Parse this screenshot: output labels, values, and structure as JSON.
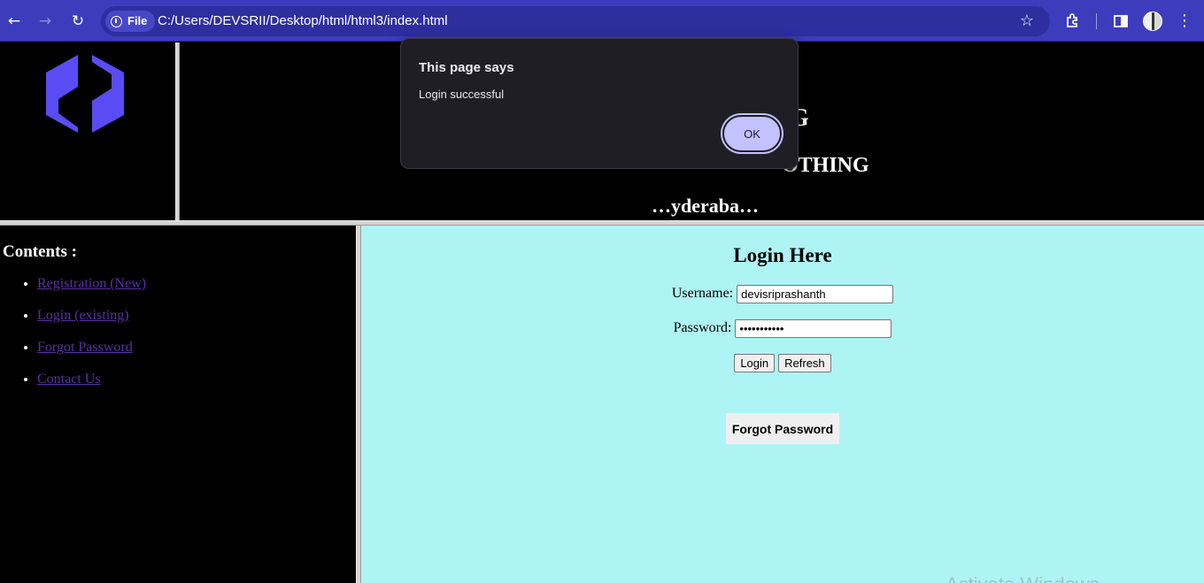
{
  "browser": {
    "site_chip_label": "File",
    "url": "C:/Users/DEVSRII/Desktop/html/html3/index.html",
    "icons": [
      "back-icon",
      "forward-icon",
      "reload-icon",
      "info-icon",
      "star-icon",
      "extensions-icon",
      "side-panel-icon",
      "profile-avatar",
      "menu-icon"
    ]
  },
  "banner": {
    "line1": "G",
    "line2": "OTHING",
    "line3": "…yderaba…"
  },
  "contents": {
    "title": "Contents :",
    "links": [
      {
        "label": "Registration (New)"
      },
      {
        "label": "Login (existing)"
      },
      {
        "label": "Forgot Password"
      },
      {
        "label": "Contact Us"
      }
    ]
  },
  "login": {
    "title": "Login Here",
    "username_label": "Username:",
    "username_value": "devisriprashanth",
    "password_label": "Password:",
    "password_value": "devisri1234",
    "login_button": "Login",
    "refresh_button": "Refresh",
    "forgot_button": "Forgot Password"
  },
  "alert": {
    "title": "This page says",
    "message": "Login successful",
    "ok_label": "OK"
  },
  "watermark": "Activate Windows",
  "colors": {
    "chrome": "#3c3cbd",
    "login_background": "#aff4f4",
    "link": "#5b2fa6",
    "logo": "#5a4cf5",
    "alert_background": "#1f1e25",
    "alert_button": "#c4c1ff"
  }
}
